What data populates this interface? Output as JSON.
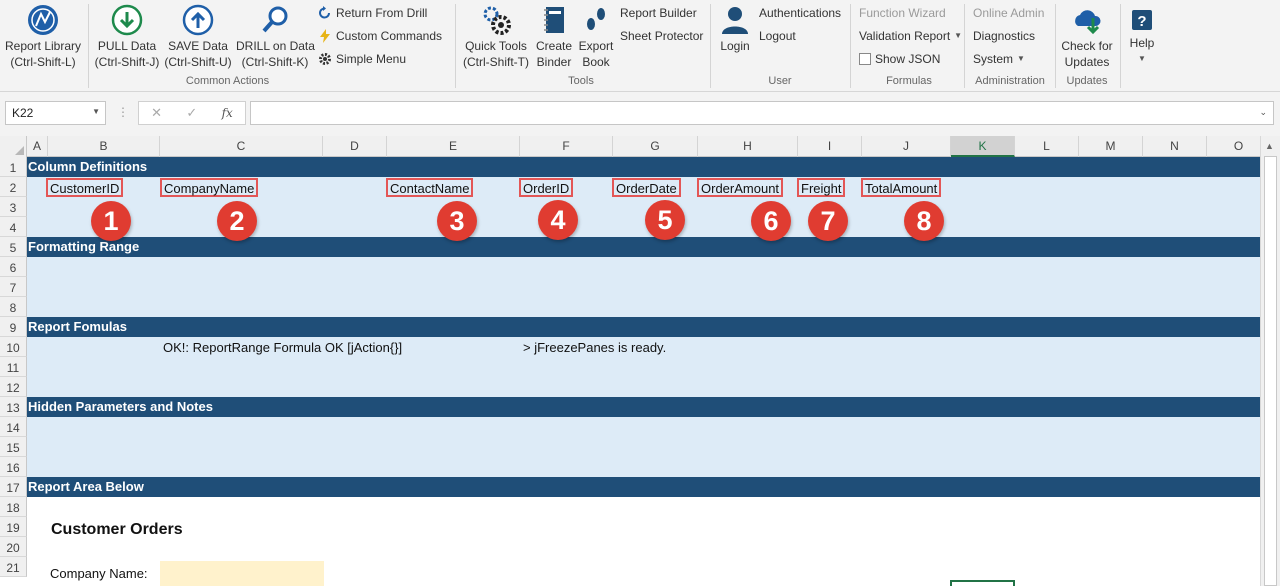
{
  "ribbon": {
    "report_library": "Report Library",
    "report_library_key": "(Ctrl-Shift-L)",
    "pull_data": "PULL Data",
    "pull_data_key": "(Ctrl-Shift-J)",
    "save_data": "SAVE Data",
    "save_data_key": "(Ctrl-Shift-U)",
    "drill_data": "DRILL on Data",
    "drill_data_key": "(Ctrl-Shift-K)",
    "return_from_drill": "Return From Drill",
    "custom_commands": "Custom Commands",
    "simple_menu": "Simple Menu",
    "group_common": "Common Actions",
    "quick_tools": "Quick Tools",
    "quick_tools_key": "(Ctrl-Shift-T)",
    "create_binder_1": "Create",
    "create_binder_2": "Binder",
    "export_book_1": "Export",
    "export_book_2": "Book",
    "report_builder": "Report Builder",
    "sheet_protector": "Sheet Protector",
    "group_tools": "Tools",
    "login": "Login",
    "authentications": "Authentications",
    "logout": "Logout",
    "group_user": "User",
    "function_wizard": "Function Wizard",
    "validation_report": "Validation Report",
    "show_json": "Show JSON",
    "group_formulas": "Formulas",
    "online_admin": "Online Admin",
    "diagnostics": "Diagnostics",
    "system": "System",
    "group_admin": "Administration",
    "check_updates_1": "Check for",
    "check_updates_2": "Updates",
    "group_updates": "Updates",
    "help": "Help"
  },
  "formula_bar": {
    "name_box": "K22",
    "fx": "fx",
    "cancel": "✕",
    "enter": "✓",
    "content": ""
  },
  "columns": [
    "A",
    "B",
    "C",
    "D",
    "E",
    "F",
    "G",
    "H",
    "I",
    "J",
    "K",
    "L",
    "M",
    "N",
    "O"
  ],
  "selected_column": "K",
  "rows": [
    "1",
    "2",
    "3",
    "4",
    "5",
    "6",
    "7",
    "8",
    "9",
    "10",
    "11",
    "12",
    "13",
    "14",
    "15",
    "16",
    "17",
    "18",
    "19",
    "20",
    "21"
  ],
  "sections": {
    "column_definitions": "Column Definitions",
    "formatting_range": "Formatting Range",
    "report_formulas": "Report Fomulas",
    "hidden_parameters": "Hidden Parameters and Notes",
    "report_area": "Report Area Below"
  },
  "column_defs": [
    "CustomerID",
    "CompanyName",
    "ContactName",
    "OrderID",
    "OrderDate",
    "OrderAmount",
    "Freight",
    "TotalAmount"
  ],
  "markers": [
    "1",
    "2",
    "3",
    "4",
    "5",
    "6",
    "7",
    "8"
  ],
  "formula_status": "OK!: ReportRange Formula OK [jAction{}]",
  "freeze_status": "> jFreezePanes is ready.",
  "report": {
    "title": "Customer Orders",
    "company_label": "Company Name:"
  },
  "colors": {
    "section_header": "#1f4e78",
    "section_fill": "#ddebf7",
    "marker": "#e03c31",
    "input_fill": "#fff2cc",
    "selection": "#217346"
  }
}
